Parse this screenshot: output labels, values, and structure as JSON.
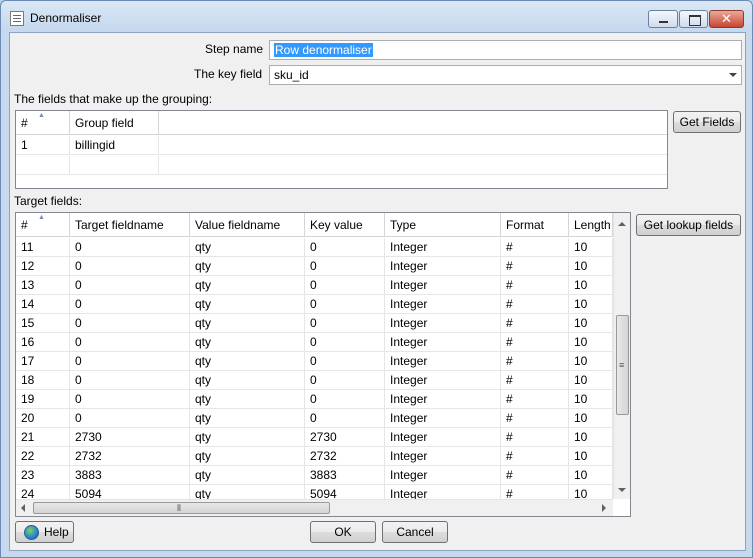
{
  "window": {
    "title": "Denormaliser"
  },
  "form": {
    "step_name_label": "Step name",
    "step_name_value": "Row denormaliser",
    "key_field_label": "The key field",
    "key_field_value": "sku_id",
    "grouping_label": "The fields that make up the grouping:",
    "target_label": "Target fields:"
  },
  "grouping_table": {
    "columns": [
      "#",
      "Group field"
    ],
    "rows": [
      {
        "num": "1",
        "field": "billingid"
      }
    ]
  },
  "target_table": {
    "columns": [
      "#",
      "Target fieldname",
      "Value fieldname",
      "Key value",
      "Type",
      "Format",
      "Length"
    ],
    "rows": [
      [
        "11",
        "0",
        "qty",
        "0",
        "Integer",
        "#",
        "10"
      ],
      [
        "12",
        "0",
        "qty",
        "0",
        "Integer",
        "#",
        "10"
      ],
      [
        "13",
        "0",
        "qty",
        "0",
        "Integer",
        "#",
        "10"
      ],
      [
        "14",
        "0",
        "qty",
        "0",
        "Integer",
        "#",
        "10"
      ],
      [
        "15",
        "0",
        "qty",
        "0",
        "Integer",
        "#",
        "10"
      ],
      [
        "16",
        "0",
        "qty",
        "0",
        "Integer",
        "#",
        "10"
      ],
      [
        "17",
        "0",
        "qty",
        "0",
        "Integer",
        "#",
        "10"
      ],
      [
        "18",
        "0",
        "qty",
        "0",
        "Integer",
        "#",
        "10"
      ],
      [
        "19",
        "0",
        "qty",
        "0",
        "Integer",
        "#",
        "10"
      ],
      [
        "20",
        "0",
        "qty",
        "0",
        "Integer",
        "#",
        "10"
      ],
      [
        "21",
        "2730",
        "qty",
        "2730",
        "Integer",
        "#",
        "10"
      ],
      [
        "22",
        "2732",
        "qty",
        "2732",
        "Integer",
        "#",
        "10"
      ],
      [
        "23",
        "3883",
        "qty",
        "3883",
        "Integer",
        "#",
        "10"
      ],
      [
        "24",
        "5094",
        "qty",
        "5094",
        "Integer",
        "#",
        "10"
      ]
    ]
  },
  "buttons": {
    "get_fields": "Get Fields",
    "get_lookup_fields": "Get lookup fields",
    "help": "Help",
    "ok": "OK",
    "cancel": "Cancel"
  },
  "icons": {
    "app": "spreadsheet-icon",
    "help": "help-globe-icon",
    "minimize": "minimize-icon",
    "maximize": "maximize-icon",
    "close": "close-icon"
  },
  "colors": {
    "selection": "#3399ff",
    "titlebar": "#c6d9ee"
  }
}
